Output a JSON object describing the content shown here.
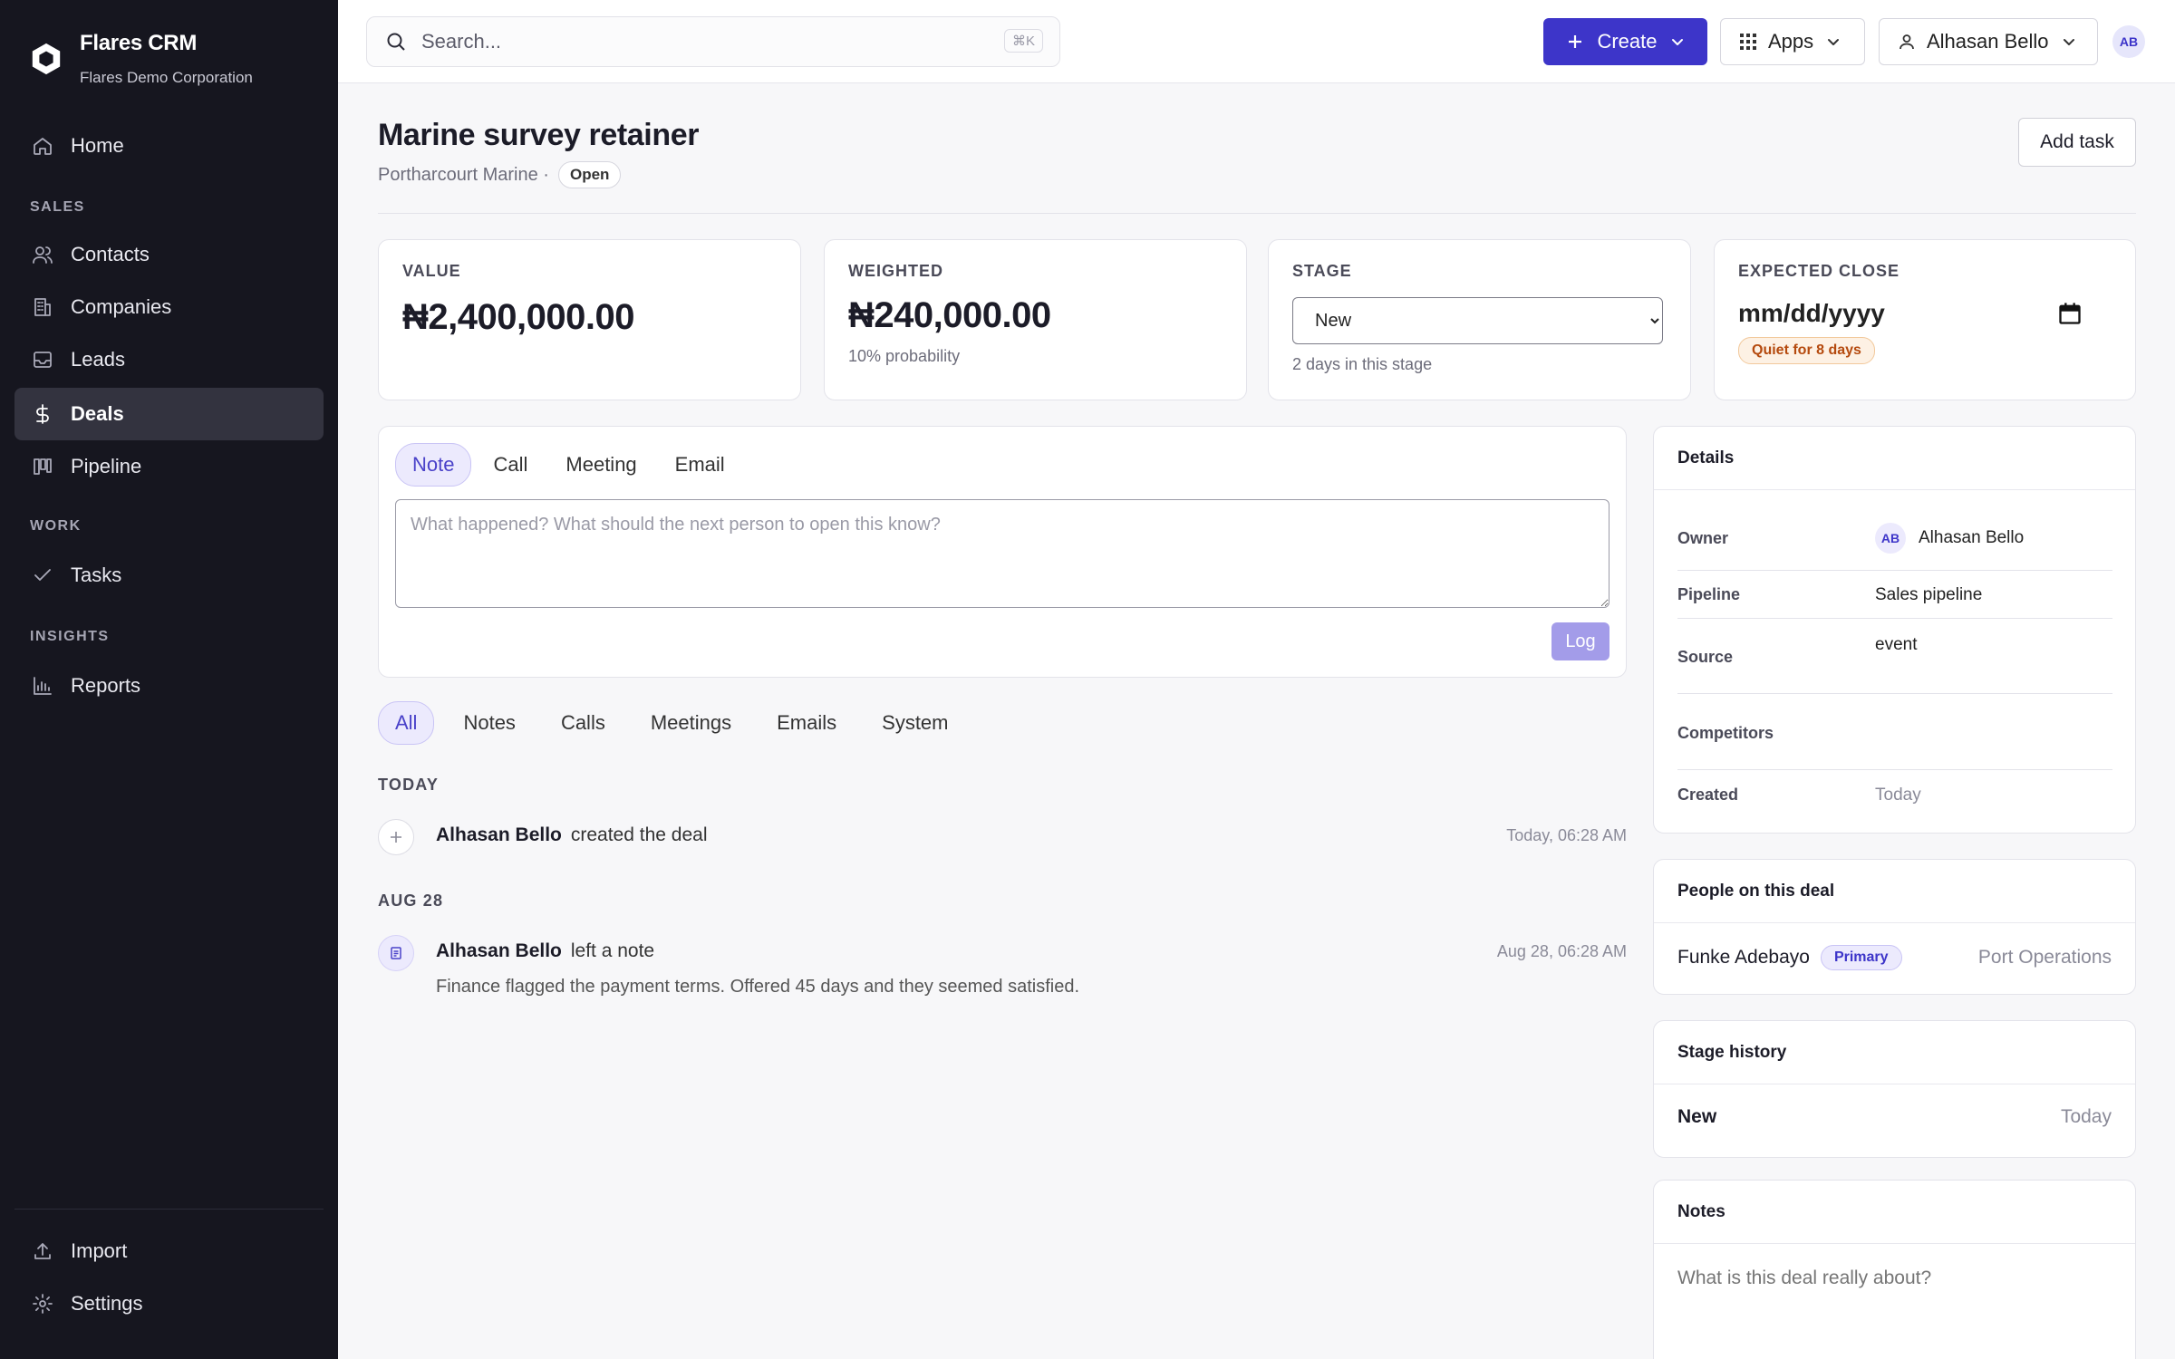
{
  "brand": {
    "name": "Flares CRM",
    "org": "Flares Demo Corporation"
  },
  "nav": {
    "home": "Home",
    "section_sales": "SALES",
    "contacts": "Contacts",
    "companies": "Companies",
    "leads": "Leads",
    "deals": "Deals",
    "pipeline": "Pipeline",
    "section_work": "WORK",
    "tasks": "Tasks",
    "section_insights": "INSIGHTS",
    "reports": "Reports",
    "import": "Import",
    "settings": "Settings"
  },
  "topbar": {
    "search_placeholder": "Search...",
    "search_shortcut": "⌘K",
    "create_label": "Create",
    "apps_label": "Apps",
    "user_label": "Alhasan Bello",
    "user_initials": "AB"
  },
  "deal": {
    "title": "Marine survey retainer",
    "company": "Portharcourt Marine ·",
    "status": "Open",
    "add_task_label": "Add task"
  },
  "stats": {
    "value_label": "VALUE",
    "value": "₦2,400,000.00",
    "weighted_label": "WEIGHTED",
    "weighted": "₦240,000.00",
    "probability": "10% probability",
    "stage_label": "STAGE",
    "stage_selected": "New",
    "stage_note": "2 days in this stage",
    "close_label": "EXPECTED CLOSE",
    "close_value": "mm/dd/yyyy",
    "quiet_badge": "Quiet for 8 days"
  },
  "composer": {
    "tabs": [
      "Note",
      "Call",
      "Meeting",
      "Email"
    ],
    "placeholder": "What happened? What should the next person to open this know?",
    "log_label": "Log"
  },
  "filters": [
    "All",
    "Notes",
    "Calls",
    "Meetings",
    "Emails",
    "System"
  ],
  "timeline": {
    "today_label": "TODAY",
    "event1": {
      "actor": "Alhasan Bello",
      "action": "created the deal",
      "time": "Today, 06:28 AM"
    },
    "aug_label": "AUG 28",
    "event2": {
      "actor": "Alhasan Bello",
      "action": "left a note",
      "time": "Aug 28, 06:28 AM",
      "body": "Finance flagged the payment terms. Offered 45 days and they seemed satisfied."
    }
  },
  "details": {
    "title": "Details",
    "owner_key": "Owner",
    "owner_initials": "AB",
    "owner_val": "Alhasan Bello",
    "pipeline_key": "Pipeline",
    "pipeline_val": "Sales pipeline",
    "source_key": "Source",
    "source_val": "event",
    "competitors_key": "Competitors",
    "created_key": "Created",
    "created_val": "Today"
  },
  "people": {
    "title": "People on this deal",
    "name": "Funke Adebayo",
    "badge": "Primary",
    "role": "Port Operations"
  },
  "stage_history": {
    "title": "Stage history",
    "stage": "New",
    "when": "Today"
  },
  "notes_card": {
    "title": "Notes",
    "placeholder": "What is this deal really about?"
  },
  "colors": {
    "accent": "#3d35c9",
    "sidebar": "#16161f",
    "warning": "#b54a0e"
  }
}
